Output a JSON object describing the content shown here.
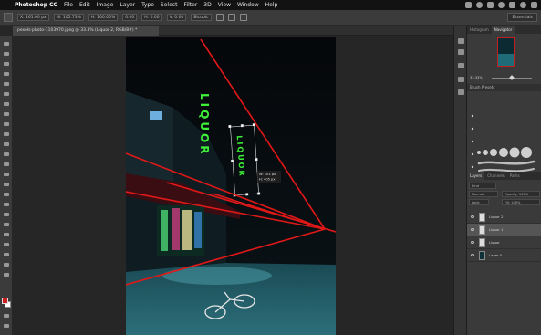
{
  "menubar": {
    "apple_icon": "apple-icon",
    "app_name": "Photoshop CC",
    "items": [
      "File",
      "Edit",
      "Image",
      "Layer",
      "Type",
      "Select",
      "Filter",
      "3D",
      "View",
      "Window",
      "Help"
    ]
  },
  "optionsbar": {
    "fields": [
      "X: 161.00 px",
      "W: 105.73%",
      "H: 100.00%",
      "0.00",
      "H: 0.00",
      "V: 0.00"
    ],
    "interpolation": "Bicubic",
    "workspace": "Essentials"
  },
  "document": {
    "tab_title": "pexels-photo-1103970.jpeg @ 33.3% (Liquor 2, RGB/8#) *"
  },
  "image_content": {
    "sign_vertical": "LIQUOR",
    "sign_transformed": "LIQUOR",
    "transform_readout": [
      "W: 103 px",
      "H: 405 px"
    ],
    "annotation_color": "#e01818",
    "neon_color": "#3ef23a"
  },
  "panels": {
    "top_tabs": [
      "Histogram",
      "Navigator"
    ],
    "active_top_tab": "Navigator",
    "zoom": "33.33%",
    "brush_header": "Brush Presets",
    "layers_tabs": [
      "Layers",
      "Channels",
      "Paths"
    ],
    "active_layers_tab": "Layers",
    "kind_filter": "Kind",
    "blend_mode": "Normal",
    "opacity": "Opacity: 100%",
    "fill": "Fill: 100%",
    "lock_label": "Lock:",
    "layers": [
      {
        "name": "Liquor 2",
        "selected": false,
        "photo": false
      },
      {
        "name": "Liquor 1",
        "selected": true,
        "photo": false
      },
      {
        "name": "Liquor",
        "selected": false,
        "photo": false
      },
      {
        "name": "Layer 0",
        "selected": false,
        "photo": true
      }
    ]
  }
}
